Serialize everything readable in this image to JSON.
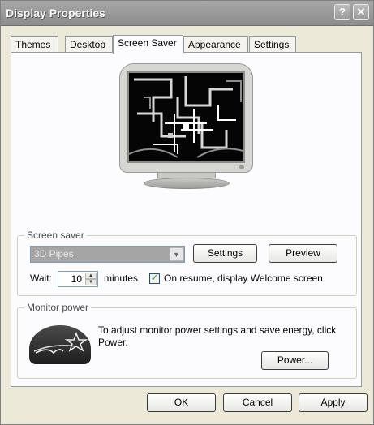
{
  "window": {
    "title": "Display Properties",
    "help_glyph": "?",
    "close_glyph": "✕"
  },
  "tabs": [
    {
      "label": "Themes"
    },
    {
      "label": "Desktop"
    },
    {
      "label": "Screen Saver"
    },
    {
      "label": "Appearance"
    },
    {
      "label": "Settings"
    }
  ],
  "screen_saver": {
    "group_label": "Screen saver",
    "selected": "3D Pipes",
    "settings_button": "Settings",
    "preview_button": "Preview",
    "wait_label": "Wait:",
    "wait_value": "10",
    "minutes_label": "minutes",
    "resume_label": "On resume, display Welcome screen",
    "resume_checked": true
  },
  "monitor_power": {
    "group_label": "Monitor power",
    "description": "To adjust monitor power settings and save energy, click Power.",
    "power_button": "Power..."
  },
  "footer": {
    "ok": "OK",
    "cancel": "Cancel",
    "apply": "Apply"
  },
  "colors": {
    "titlebar": "#9a9a9a",
    "dialog_bg": "#ece9d8",
    "panel_bg": "#fcfcfe",
    "combo_selected": "#a5a5a5"
  }
}
